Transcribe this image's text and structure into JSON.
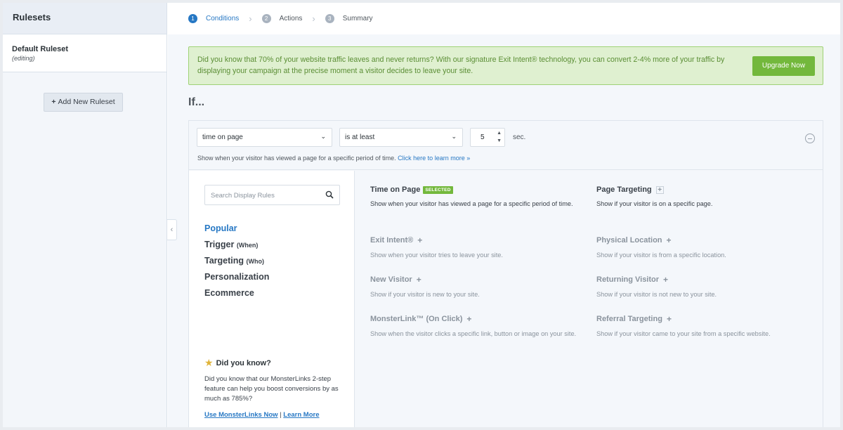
{
  "sidebar": {
    "header": "Rulesets",
    "ruleset": {
      "name": "Default Ruleset",
      "status": "(editing)"
    },
    "add_button": "Add New Ruleset"
  },
  "steps": [
    {
      "num": "1",
      "label": "Conditions"
    },
    {
      "num": "2",
      "label": "Actions"
    },
    {
      "num": "3",
      "label": "Summary"
    }
  ],
  "notice": {
    "text": "Did you know that 70% of your website traffic leaves and never returns? With our signature Exit Intent® technology, you can convert 2-4% more of your traffic by displaying your campaign at the precise moment a visitor decides to leave your site.",
    "button": "Upgrade Now"
  },
  "if_title": "If...",
  "condition": {
    "field": "time on page",
    "operator": "is at least",
    "value": "5",
    "unit": "sec.",
    "help": "Show when your visitor has viewed a page for a specific period of time.",
    "help_link": "Click here to learn more »"
  },
  "rules_panel": {
    "search_placeholder": "Search Display Rules",
    "categories": [
      {
        "label": "Popular",
        "sub": ""
      },
      {
        "label": "Trigger",
        "sub": "(When)"
      },
      {
        "label": "Targeting",
        "sub": "(Who)"
      },
      {
        "label": "Personalization",
        "sub": ""
      },
      {
        "label": "Ecommerce",
        "sub": ""
      }
    ],
    "did_you_know": {
      "title": "Did you know?",
      "text": "Did you know that our MonsterLinks 2-step feature can help you boost conversions by as much as 785%?",
      "link1": "Use MonsterLinks Now",
      "separator": "|",
      "link2": "Learn More"
    },
    "rules": [
      {
        "title": "Time on Page",
        "badge": "SELECTED",
        "desc": "Show when your visitor has viewed a page for a specific period of time."
      },
      {
        "title": "Page Targeting",
        "desc": "Show if your visitor is on a specific page."
      },
      {
        "title": "Exit Intent®",
        "desc": "Show when your visitor tries to leave your site."
      },
      {
        "title": "Physical Location",
        "desc": "Show if your visitor is from a specific location."
      },
      {
        "title": "New Visitor",
        "desc": "Show if your visitor is new to your site."
      },
      {
        "title": "Returning Visitor",
        "desc": "Show if your visitor is not new to your site."
      },
      {
        "title": "MonsterLink™ (On Click)",
        "desc": "Show when the visitor clicks a specific link, button or image on your site."
      },
      {
        "title": "Referral Targeting",
        "desc": "Show if your visitor came to your site from a specific website."
      }
    ]
  },
  "colors": {
    "accent": "#2778c4",
    "success": "#73b83c",
    "notice_bg": "#dff0d0"
  }
}
